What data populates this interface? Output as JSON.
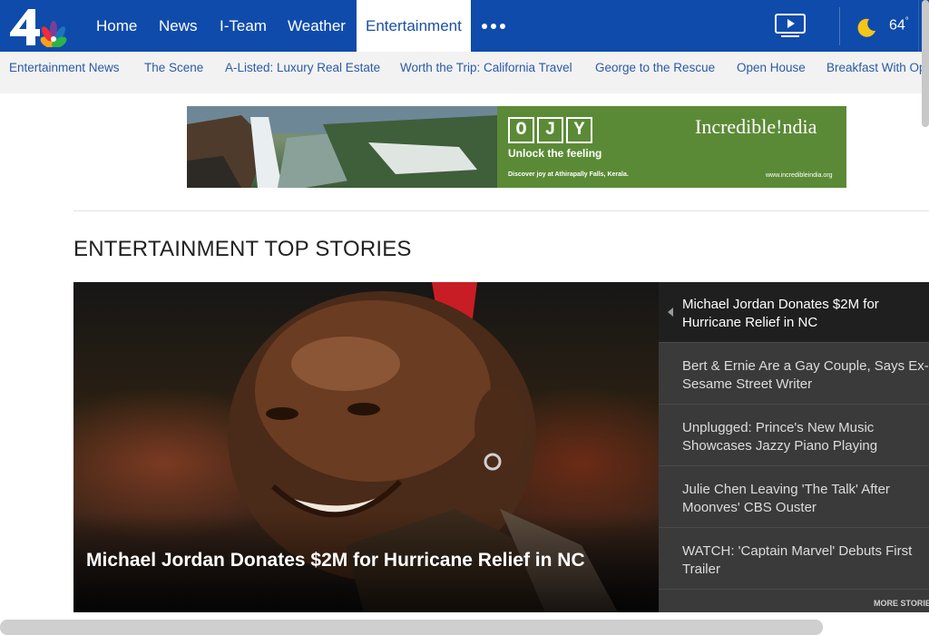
{
  "topnav": {
    "logo_alt": "NBC 4",
    "items": [
      {
        "label": "Home"
      },
      {
        "label": "News"
      },
      {
        "label": "I-Team"
      },
      {
        "label": "Weather"
      },
      {
        "label": "Entertainment",
        "active": true
      }
    ],
    "more_icon": "more-dots-icon",
    "video_icon": "video-play-icon",
    "weather_icon": "moon-icon",
    "temperature": "64",
    "temp_unit": "°"
  },
  "subnav": {
    "items": [
      {
        "label": "Entertainment News"
      },
      {
        "label": "The Scene"
      },
      {
        "label": "A-Listed: Luxury Real Estate"
      },
      {
        "label": "Worth the Trip: California Travel"
      },
      {
        "label": "George to the Rescue"
      },
      {
        "label": "Open House"
      },
      {
        "label": "Breakfast With Ops"
      }
    ]
  },
  "ad": {
    "letters": [
      "O",
      "J",
      "Y"
    ],
    "tagline": "Unlock the feeling",
    "small_text": "Discover joy at Athirapally Falls, Kerala.",
    "brand": "Incredible!ndia",
    "url": "www.incredibleindia.org"
  },
  "section": {
    "title": "ENTERTAINMENT TOP STORIES"
  },
  "hero": {
    "caption": "Michael Jordan Donates $2M for Hurricane Relief in NC"
  },
  "stories": {
    "items": [
      {
        "title": "Michael Jordan Donates $2M for\nHurricane Relief in NC",
        "active": true
      },
      {
        "title": "Bert & Ernie Are a Gay Couple, Says Ex-\nSesame Street Writer"
      },
      {
        "title": "Unplugged: Prince's New Music\nShowcases Jazzy Piano Playing"
      },
      {
        "title": "Julie Chen Leaving 'The Talk' After\nMoonves' CBS Ouster"
      },
      {
        "title": "WATCH: 'Captain Marvel' Debuts First\nTrailer"
      }
    ],
    "more_label": "MORE STORIES"
  },
  "colors": {
    "nav_blue": "#0f4bab",
    "link_blue": "#2b5aa6",
    "story_bg": "#3a3a3a",
    "story_active_bg": "#1f1f1f"
  }
}
